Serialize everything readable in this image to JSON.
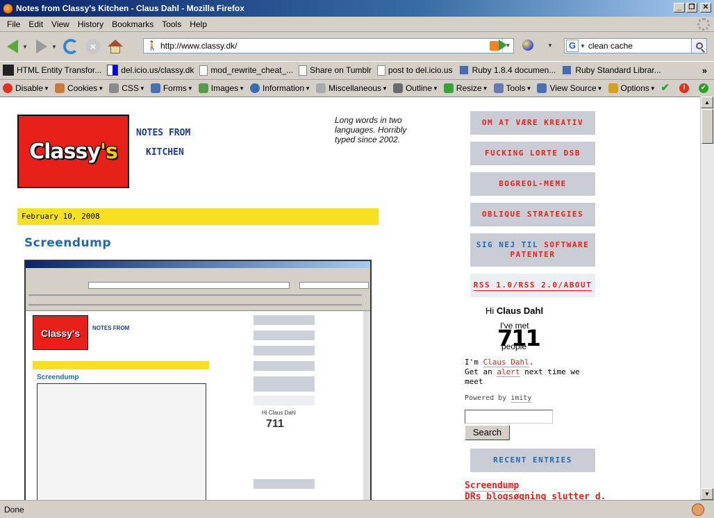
{
  "window": {
    "title": "Notes from Classy's Kitchen - Claus Dahl - Mozilla Firefox",
    "btn_minimize": "_",
    "btn_maximize": "❐",
    "btn_close": "✕"
  },
  "menu": {
    "items": [
      "File",
      "Edit",
      "View",
      "History",
      "Bookmarks",
      "Tools",
      "Help"
    ]
  },
  "nav": {
    "url": "http://www.classy.dk/",
    "search_value": "clean cache",
    "search_engine_glyph": "G"
  },
  "bookmarks": {
    "items": [
      {
        "label": "HTML Entity Transfor...",
        "icon": "dark"
      },
      {
        "label": "del.icio.us/classy.dk",
        "icon": "delicious"
      },
      {
        "label": "mod_rewrite_cheat_...",
        "icon": "page"
      },
      {
        "label": "Share on Tumblr",
        "icon": "page"
      },
      {
        "label": "post to del.icio.us",
        "icon": "page"
      },
      {
        "label": "Ruby 1.8.4 documen...",
        "icon": "ruby"
      },
      {
        "label": "Ruby Standard Librar...",
        "icon": "ruby"
      }
    ],
    "more": "»"
  },
  "devtoolbar": {
    "items": [
      {
        "label": "Disable",
        "color": "#e03020"
      },
      {
        "label": "Cookies",
        "color": "#c87a3a"
      },
      {
        "label": "CSS",
        "color": "#8a8a8a"
      },
      {
        "label": "Forms",
        "color": "#4a70b0"
      },
      {
        "label": "Images",
        "color": "#5a9a4a"
      },
      {
        "label": "Information",
        "color": "#3a6ab0"
      },
      {
        "label": "Miscellaneous",
        "color": "#aaaaaa"
      },
      {
        "label": "Outline",
        "color": "#6a6a6a"
      },
      {
        "label": "Resize",
        "color": "#3aa03a"
      },
      {
        "label": "Tools",
        "color": "#6a7ab0"
      },
      {
        "label": "View Source",
        "color": "#4a70b0"
      },
      {
        "label": "Options",
        "color": "#d4a020"
      }
    ],
    "status_ok": "✔",
    "status_err": "!",
    "status_valid": "✓"
  },
  "page": {
    "logo": {
      "text_a": "Classy",
      "text_b": "'s"
    },
    "notes_line1": "NOTES FROM",
    "notes_line2": "KITCHEN",
    "tagline": "Long words in two languages. Horribly typed since 2002.",
    "date": "February 10, 2008",
    "post_title": "Screendump",
    "shot": {
      "logo": "Classy's",
      "notes": "NOTES FROM",
      "title": "Screendump",
      "counter": "711",
      "hi": "Hi Claus Dahl"
    }
  },
  "sidebar": {
    "buttons": [
      {
        "label": "OM AT VÆRE KREATIV"
      },
      {
        "label": "FUCKING LORTE DSB"
      },
      {
        "label": "BOGREOL-MEME"
      },
      {
        "label": "OBLIQUE STRATEGIES"
      }
    ],
    "patent_a": "SIG NEJ TIL",
    "patent_b": "SOFTWARE PATENTER",
    "rss": "RSS 1.0/RSS 2.0/ABOUT",
    "hi_prefix": "Hi",
    "hi_name": "Claus Dahl",
    "counter_top": "I've met",
    "counter_num": "711",
    "counter_bot": "people",
    "im_prefix": "I'm",
    "im_name": "Claus Dahl",
    "im_period": ".",
    "alert_prefix": "Get an",
    "alert_link": "alert",
    "alert_suffix": "next time we meet",
    "powered_prefix": "Powered by",
    "powered_link": "imity",
    "search_button": "Search",
    "recent_title": "RECENT ENTRIES",
    "recent": [
      "Screendump",
      "DRs blogsøgning slutter d."
    ]
  },
  "status": {
    "text": "Done"
  }
}
